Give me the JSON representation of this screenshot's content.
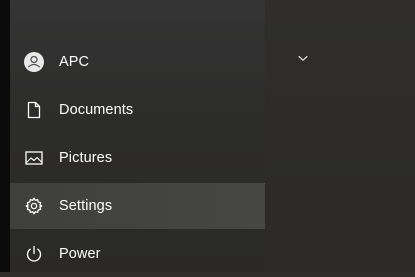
{
  "start_menu": {
    "items": [
      {
        "label": "APC",
        "icon": "user-avatar-icon",
        "selected": false
      },
      {
        "label": "Documents",
        "icon": "document-icon",
        "selected": false
      },
      {
        "label": "Pictures",
        "icon": "pictures-icon",
        "selected": false
      },
      {
        "label": "Settings",
        "icon": "gear-icon",
        "selected": true
      },
      {
        "label": "Power",
        "icon": "power-icon",
        "selected": false
      }
    ]
  },
  "tiles": {
    "group_toggle_icon": "chevron-down-icon"
  },
  "colors": {
    "menu_background": "#2c2c2b",
    "selected_background": "#444443",
    "text": "#ffffff"
  }
}
